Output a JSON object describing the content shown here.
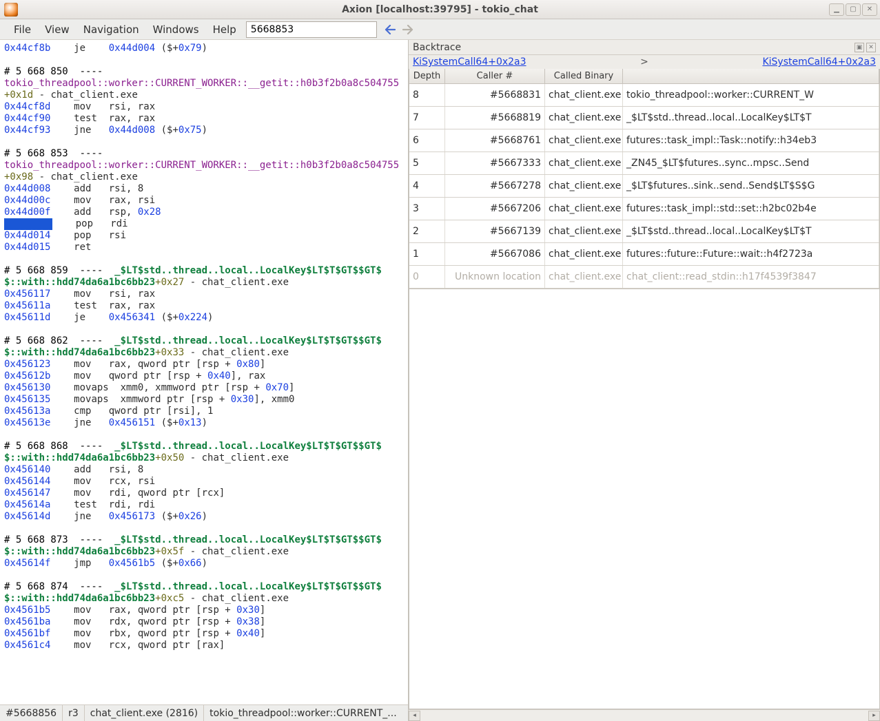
{
  "window": {
    "title": "Axion [localhost:39795] - tokio_chat"
  },
  "menu": {
    "file": "File",
    "view": "View",
    "navigation": "Navigation",
    "windows": "Windows",
    "help": "Help"
  },
  "search": {
    "value": "5668853"
  },
  "code": {
    "l01a": "0x44cf8b",
    "l01b": "    je    ",
    "l01c": "0x44d004",
    "l01d": " ($+",
    "l01e": "0x79",
    "l01f": ")",
    "b1h": "# 5 668 850  ----",
    "b1s": "tokio_threadpool::worker::CURRENT_WORKER::__getit::h0b3f2b0a8c504755",
    "b1off": "+0x1d",
    "b1bin": " - chat_client.exe",
    "b1l1a": "0x44cf8d",
    "b1l1b": "    mov   rsi, rax",
    "b1l2a": "0x44cf90",
    "b1l2b": "    test  rax, rax",
    "b1l3a": "0x44cf93",
    "b1l3b": "    jne   ",
    "b1l3c": "0x44d008",
    "b1l3d": " ($+",
    "b1l3e": "0x75",
    "b1l3f": ")",
    "b2h": "# 5 668 853  ----",
    "b2s": "tokio_threadpool::worker::CURRENT_WORKER::__getit::h0b3f2b0a8c504755",
    "b2off": "+0x98",
    "b2bin": " - chat_client.exe",
    "b2l1a": "0x44d008",
    "b2l1b": "    add   rsi, 8",
    "b2l2a": "0x44d00c",
    "b2l2b": "    mov   rax, rsi",
    "b2l3a": "0x44d00f",
    "b2l3b": "    add   rsp, ",
    "b2l3c": "0x28",
    "b2l4b": "    pop   rdi",
    "b2l5a": "0x44d014",
    "b2l5b": "    pop   rsi",
    "b2l6a": "0x44d015",
    "b2l6b": "    ret",
    "b3h": "# 5 668 859  ----  ",
    "b3sym": "_$LT$std..thread..local..LocalKey$LT$T$GT$$GT$",
    "b3p": "$::with::hdd74da6a1bc6bb23",
    "b3off": "+0x27",
    "b3bin": " - chat_client.exe",
    "b3l1a": "0x456117",
    "b3l1b": "    mov   rsi, rax",
    "b3l2a": "0x45611a",
    "b3l2b": "    test  rax, rax",
    "b3l3a": "0x45611d",
    "b3l3b": "    je    ",
    "b3l3c": "0x456341",
    "b3l3d": " ($+",
    "b3l3e": "0x224",
    "b3l3f": ")",
    "b4h": "# 5 668 862  ----  ",
    "b4sym": "_$LT$std..thread..local..LocalKey$LT$T$GT$$GT$",
    "b4p": "$::with::hdd74da6a1bc6bb23",
    "b4off": "+0x33",
    "b4bin": " - chat_client.exe",
    "b4l1a": "0x456123",
    "b4l1b": "    mov   rax, qword ptr [rsp + ",
    "b4l1c": "0x80",
    "b4l1d": "]",
    "b4l2a": "0x45612b",
    "b4l2b": "    mov   qword ptr [rsp + ",
    "b4l2c": "0x40",
    "b4l2d": "], rax",
    "b4l3a": "0x456130",
    "b4l3b": "    movaps  xmm0, xmmword ptr [rsp + ",
    "b4l3c": "0x70",
    "b4l3d": "]",
    "b4l4a": "0x456135",
    "b4l4b": "    movaps  xmmword ptr [rsp + ",
    "b4l4c": "0x30",
    "b4l4d": "], xmm0",
    "b4l5a": "0x45613a",
    "b4l5b": "    cmp   qword ptr [rsi], 1",
    "b4l6a": "0x45613e",
    "b4l6b": "    jne   ",
    "b4l6c": "0x456151",
    "b4l6d": " ($+",
    "b4l6e": "0x13",
    "b4l6f": ")",
    "b5h": "# 5 668 868  ----  ",
    "b5sym": "_$LT$std..thread..local..LocalKey$LT$T$GT$$GT$",
    "b5p": "$::with::hdd74da6a1bc6bb23",
    "b5off": "+0x50",
    "b5bin": " - chat_client.exe",
    "b5l1a": "0x456140",
    "b5l1b": "    add   rsi, 8",
    "b5l2a": "0x456144",
    "b5l2b": "    mov   rcx, rsi",
    "b5l3a": "0x456147",
    "b5l3b": "    mov   rdi, qword ptr [rcx]",
    "b5l4a": "0x45614a",
    "b5l4b": "    test  rdi, rdi",
    "b5l5a": "0x45614d",
    "b5l5b": "    jne   ",
    "b5l5c": "0x456173",
    "b5l5d": " ($+",
    "b5l5e": "0x26",
    "b5l5f": ")",
    "b6h": "# 5 668 873  ----  ",
    "b6sym": "_$LT$std..thread..local..LocalKey$LT$T$GT$$GT$",
    "b6p": "$::with::hdd74da6a1bc6bb23",
    "b6off": "+0x5f",
    "b6bin": " - chat_client.exe",
    "b6l1a": "0x45614f",
    "b6l1b": "    jmp   ",
    "b6l1c": "0x4561b5",
    "b6l1d": " ($+",
    "b6l1e": "0x66",
    "b6l1f": ")",
    "b7h": "# 5 668 874  ----  ",
    "b7sym": "_$LT$std..thread..local..LocalKey$LT$T$GT$$GT$",
    "b7p": "$::with::hdd74da6a1bc6bb23",
    "b7off": "+0xc5",
    "b7bin": " - chat_client.exe",
    "b7l1a": "0x4561b5",
    "b7l1b": "    mov   rax, qword ptr [rsp + ",
    "b7l1c": "0x30",
    "b7l1d": "]",
    "b7l2a": "0x4561ba",
    "b7l2b": "    mov   rdx, qword ptr [rsp + ",
    "b7l2c": "0x38",
    "b7l2d": "]",
    "b7l3a": "0x4561bf",
    "b7l3b": "    mov   rbx, qword ptr [rsp + ",
    "b7l3c": "0x40",
    "b7l3d": "]",
    "b7l4a": "0x4561c4",
    "b7l4b": "    mov   rcx, qword ptr [rax]"
  },
  "backtrace": {
    "label": "Backtrace",
    "link_left": "KiSystemCall64+0x2a3",
    "sep": ">",
    "link_right": "KiSystemCall64+0x2a3",
    "cols": {
      "depth": "Depth",
      "caller": "Caller #",
      "bin": "Called Binary",
      "fn": ""
    },
    "rows": [
      {
        "d": "8",
        "c": "#5668831",
        "b": "chat_client.exe",
        "f": "tokio_threadpool::worker::CURRENT_W"
      },
      {
        "d": "7",
        "c": "#5668819",
        "b": "chat_client.exe",
        "f": "_$LT$std..thread..local..LocalKey$LT$T"
      },
      {
        "d": "6",
        "c": "#5668761",
        "b": "chat_client.exe",
        "f": "futures::task_impl::Task::notify::h34eb3"
      },
      {
        "d": "5",
        "c": "#5667333",
        "b": "chat_client.exe",
        "f": "_ZN45_$LT$futures..sync..mpsc..Send"
      },
      {
        "d": "4",
        "c": "#5667278",
        "b": "chat_client.exe",
        "f": "_$LT$futures..sink..send..Send$LT$S$G"
      },
      {
        "d": "3",
        "c": "#5667206",
        "b": "chat_client.exe",
        "f": "futures::task_impl::std::set::h2bc02b4e"
      },
      {
        "d": "2",
        "c": "#5667139",
        "b": "chat_client.exe",
        "f": "_$LT$std..thread..local..LocalKey$LT$T"
      },
      {
        "d": "1",
        "c": "#5667086",
        "b": "chat_client.exe",
        "f": "futures::future::Future::wait::h4f2723a"
      },
      {
        "d": "0",
        "c": "Unknown location",
        "b": "chat_client.exe",
        "f": "chat_client::read_stdin::h17f4539f3847"
      }
    ]
  },
  "status": {
    "s1": "#5668856",
    "s2": "r3",
    "s3": "chat_client.exe (2816)",
    "s4": "tokio_threadpool::worker::CURRENT_..."
  }
}
